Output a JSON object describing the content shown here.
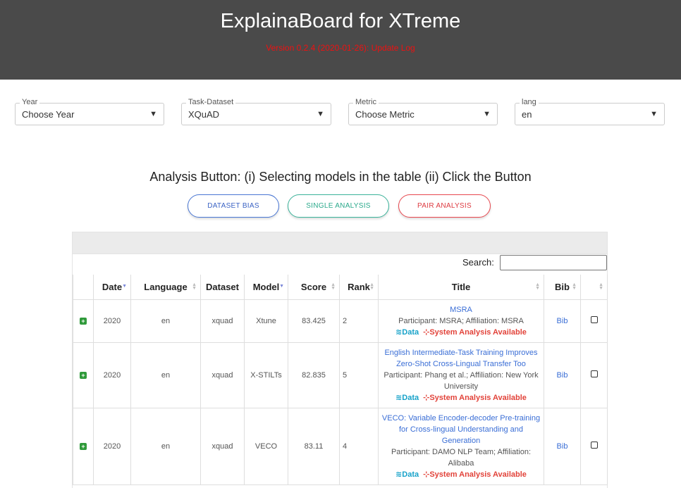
{
  "header": {
    "title": "ExplainaBoard for XTreme",
    "version": "Version 0.2.4 (2020-01-26): Update Log"
  },
  "filters": [
    {
      "label": "Year",
      "value": "Choose Year"
    },
    {
      "label": "Task-Dataset",
      "value": "XQuAD"
    },
    {
      "label": "Metric",
      "value": "Choose Metric"
    },
    {
      "label": "lang",
      "value": "en"
    }
  ],
  "analysis": {
    "title": "Analysis Button: (i) Selecting models in the table (ii) Click the Button",
    "buttons": [
      "DATASET BIAS",
      "SINGLE ANALYSIS",
      "PAIR ANALYSIS"
    ]
  },
  "search": {
    "label": "Search:",
    "placeholder": ""
  },
  "table": {
    "columns": [
      "Date",
      "Language",
      "Dataset",
      "Model",
      "Score",
      "Rank",
      "Title",
      "Bib"
    ],
    "data_label": "Data",
    "system_label": "System Analysis Available",
    "bib_label": "Bib",
    "rows": [
      {
        "date": "2020",
        "language": "en",
        "dataset": "xquad",
        "model": "Xtune",
        "score": "83.425",
        "rank": "2",
        "title": "MSRA",
        "participant": "Participant: MSRA; Affiliation: MSRA"
      },
      {
        "date": "2020",
        "language": "en",
        "dataset": "xquad",
        "model": "X-STILTs",
        "score": "82.835",
        "rank": "5",
        "title": "English Intermediate-Task Training Improves Zero-Shot Cross-Lingual Transfer Too",
        "participant": "Participant: Phang et al.; Affiliation: New York University"
      },
      {
        "date": "2020",
        "language": "en",
        "dataset": "xquad",
        "model": "VECO",
        "score": "83.11",
        "rank": "4",
        "title": "VECO: Variable Encoder-decoder Pre-training for Cross-lingual Understanding and Generation",
        "participant": "Participant: DAMO NLP Team; Affiliation: Alibaba"
      }
    ]
  },
  "colors": {
    "header_bg": "#4a4a4a",
    "version_text": "#ee1111",
    "dataset_bias": "#4a77d4",
    "single_analysis": "#3bb39a",
    "pair_analysis": "#e8484f"
  }
}
